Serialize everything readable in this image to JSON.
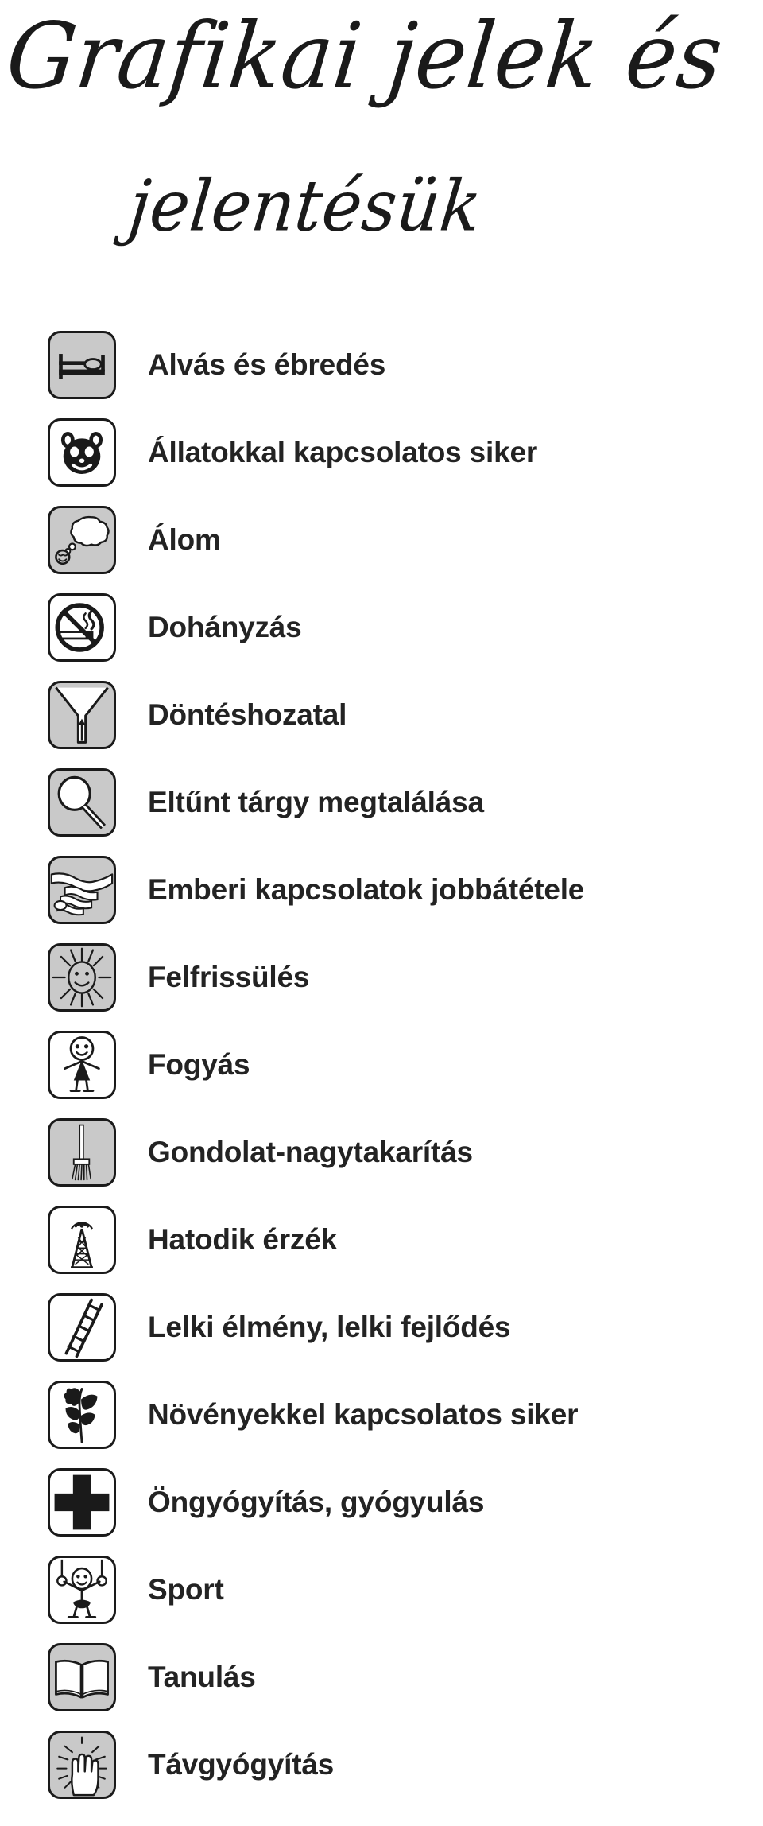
{
  "title": {
    "line1": "Grafikai jelek és",
    "line2": "jelentésük",
    "full": "Grafikai jelek és jelentésük"
  },
  "colors": {
    "ink": "#232323",
    "icon_outline": "#1a1a1a",
    "icon_gray_bg": "#c9c9c9",
    "icon_white_bg": "#ffffff",
    "page_bg": "#ffffff"
  },
  "list": {
    "items": [
      {
        "label": "Alvás és ébredés",
        "icon": "bed-icon",
        "bg": "gray"
      },
      {
        "label": "Állatokkal kapcsolatos siker",
        "icon": "animal-face-icon",
        "bg": "white"
      },
      {
        "label": "Álom",
        "icon": "dream-bubble-icon",
        "bg": "gray"
      },
      {
        "label": "Dohányzás",
        "icon": "no-smoking-icon",
        "bg": "white"
      },
      {
        "label": "Döntéshozatal",
        "icon": "fork-in-road-icon",
        "bg": "gray"
      },
      {
        "label": "Eltűnt tárgy megtalálása",
        "icon": "magnifier-icon",
        "bg": "gray"
      },
      {
        "label": "Emberi kapcsolatok jobbátétele",
        "icon": "handshake-icon",
        "bg": "gray"
      },
      {
        "label": "Felfrissülés",
        "icon": "sun-face-icon",
        "bg": "gray"
      },
      {
        "label": "Fogyás",
        "icon": "slim-person-icon",
        "bg": "white"
      },
      {
        "label": "Gondolat-nagytakarítás",
        "icon": "broom-icon",
        "bg": "gray"
      },
      {
        "label": "Hatodik érzék",
        "icon": "antenna-tower-icon",
        "bg": "white"
      },
      {
        "label": "Lelki élmény, lelki fejlődés",
        "icon": "ladder-icon",
        "bg": "white"
      },
      {
        "label": "Növényekkel kapcsolatos siker",
        "icon": "plant-icon",
        "bg": "white"
      },
      {
        "label": "Öngyógyítás, gyógyulás",
        "icon": "medical-cross-icon",
        "bg": "white"
      },
      {
        "label": "Sport",
        "icon": "gymnast-rings-icon",
        "bg": "white"
      },
      {
        "label": "Tanulás",
        "icon": "open-book-icon",
        "bg": "gray"
      },
      {
        "label": "Távgyógyítás",
        "icon": "radiating-hand-icon",
        "bg": "gray"
      }
    ]
  }
}
